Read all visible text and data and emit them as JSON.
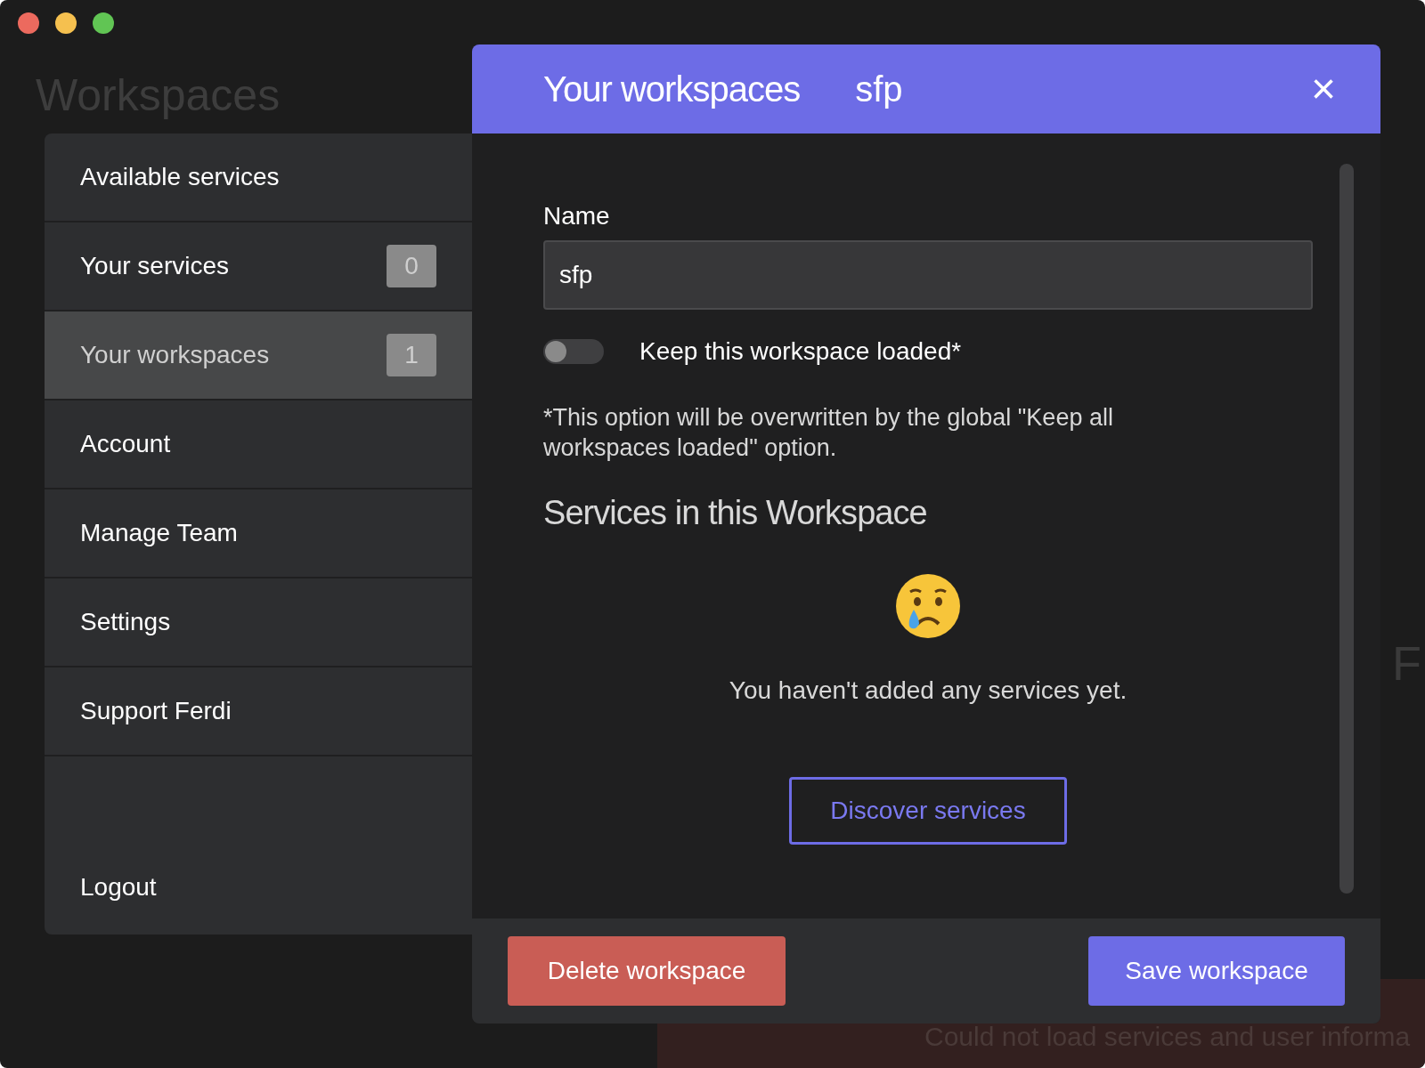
{
  "background": {
    "title": "Workspaces",
    "side_text": "F",
    "error": "Could not load services and user informa"
  },
  "menu": {
    "items": [
      {
        "label": "Available services",
        "selected": false
      },
      {
        "label": "Your services",
        "badge": "0",
        "selected": false
      },
      {
        "label": "Your workspaces",
        "badge": "1",
        "selected": true
      },
      {
        "label": "Account",
        "selected": false
      },
      {
        "label": "Manage Team",
        "selected": false
      },
      {
        "label": "Settings",
        "selected": false
      },
      {
        "label": "Support Ferdi",
        "selected": false
      }
    ],
    "logout": "Logout"
  },
  "dialog": {
    "breadcrumb": [
      "Your workspaces",
      "sfp"
    ],
    "close": "×",
    "name_label": "Name",
    "name_value": "sfp",
    "keep_loaded": {
      "label": "Keep this workspace loaded*",
      "on": false
    },
    "note": "*This option will be overwritten by the global \"Keep all workspaces loaded\" option.",
    "services_heading": "Services in this Workspace",
    "empty_text": "You haven't added any services yet.",
    "discover": "Discover services",
    "delete": "Delete workspace",
    "save": "Save workspace"
  }
}
